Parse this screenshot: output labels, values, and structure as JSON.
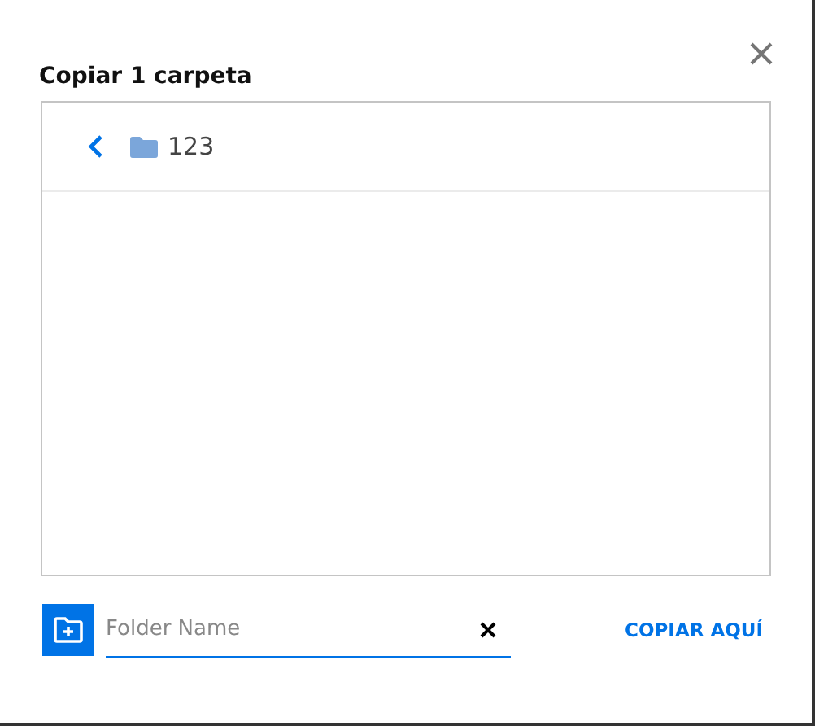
{
  "dialog": {
    "title": "Copiar 1 carpeta"
  },
  "browser": {
    "current_folder": "123"
  },
  "new_folder": {
    "placeholder": "Folder Name"
  },
  "buttons": [
    "COPIAR AQUÍ"
  ]
}
